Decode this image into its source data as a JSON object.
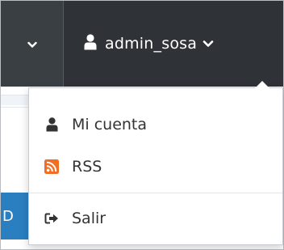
{
  "navbar": {
    "user_menu": {
      "username": "admin_sosa"
    }
  },
  "left_tab": {
    "text": "D"
  },
  "dropdown": {
    "items": [
      {
        "label": "Mi cuenta",
        "icon": "user-icon"
      },
      {
        "label": "RSS",
        "icon": "rss-icon"
      },
      {
        "label": "Salir",
        "icon": "sign-out-icon"
      }
    ]
  },
  "colors": {
    "navbar_bg": "#3a3f44",
    "user_toggle_bg": "#2f3337",
    "rss_orange": "#f26f21",
    "tab_blue": "#2a7fc0"
  }
}
